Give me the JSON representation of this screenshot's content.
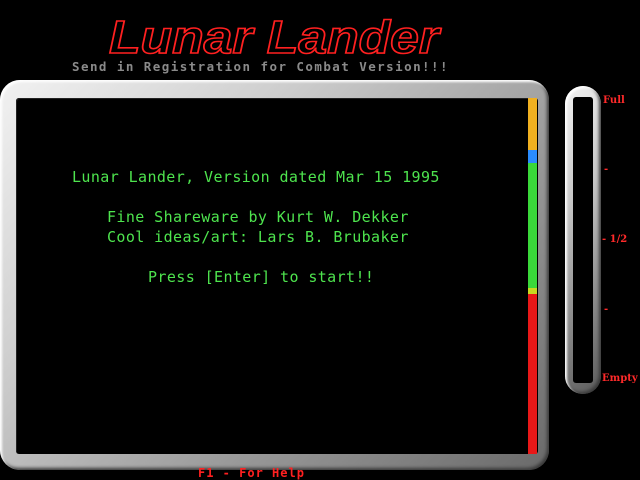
{
  "title": "Lunar Lander",
  "subtitle": "Send in Registration for Combat Version!!!",
  "screen_messages": {
    "version": "Lunar Lander, Version dated Mar 15 1995",
    "credit_author": "Fine Shareware by Kurt W. Dekker",
    "credit_art": "Cool ideas/art: Lars B. Brubaker",
    "press_start": "Press [Enter] to start!!"
  },
  "fuel_gauge": {
    "label_full": "Full",
    "label_tick_upper": "-",
    "label_half": "- 1/2",
    "label_tick_lower": "-",
    "label_empty": "Empty",
    "level_fraction": 0
  },
  "help_hint": "F1 - For Help",
  "colors": {
    "title_outline": "#ff2020",
    "message_text": "#4ee44e",
    "gauge_labels": "#ff2a2a",
    "terrain_bar": [
      "#f0b020",
      "#2a8cff",
      "#3ad83a",
      "#c8d820",
      "#e81818"
    ]
  }
}
